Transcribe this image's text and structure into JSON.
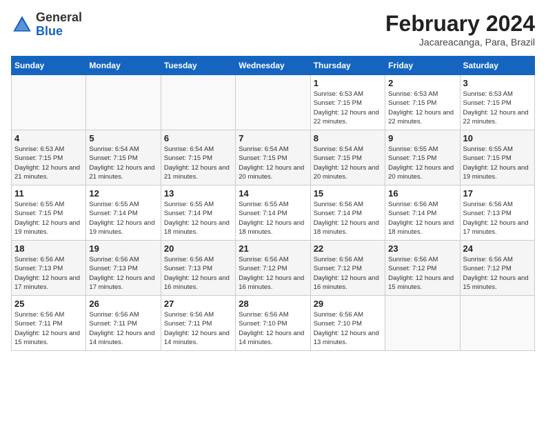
{
  "header": {
    "logo": {
      "general": "General",
      "blue": "Blue"
    },
    "month_year": "February 2024",
    "location": "Jacareacanga, Para, Brazil"
  },
  "days_of_week": [
    "Sunday",
    "Monday",
    "Tuesday",
    "Wednesday",
    "Thursday",
    "Friday",
    "Saturday"
  ],
  "weeks": [
    [
      {
        "day": "",
        "sunrise": "",
        "sunset": "",
        "daylight": ""
      },
      {
        "day": "",
        "sunrise": "",
        "sunset": "",
        "daylight": ""
      },
      {
        "day": "",
        "sunrise": "",
        "sunset": "",
        "daylight": ""
      },
      {
        "day": "",
        "sunrise": "",
        "sunset": "",
        "daylight": ""
      },
      {
        "day": "1",
        "sunrise": "Sunrise: 6:53 AM",
        "sunset": "Sunset: 7:15 PM",
        "daylight": "Daylight: 12 hours and 22 minutes."
      },
      {
        "day": "2",
        "sunrise": "Sunrise: 6:53 AM",
        "sunset": "Sunset: 7:15 PM",
        "daylight": "Daylight: 12 hours and 22 minutes."
      },
      {
        "day": "3",
        "sunrise": "Sunrise: 6:53 AM",
        "sunset": "Sunset: 7:15 PM",
        "daylight": "Daylight: 12 hours and 22 minutes."
      }
    ],
    [
      {
        "day": "4",
        "sunrise": "Sunrise: 6:53 AM",
        "sunset": "Sunset: 7:15 PM",
        "daylight": "Daylight: 12 hours and 21 minutes."
      },
      {
        "day": "5",
        "sunrise": "Sunrise: 6:54 AM",
        "sunset": "Sunset: 7:15 PM",
        "daylight": "Daylight: 12 hours and 21 minutes."
      },
      {
        "day": "6",
        "sunrise": "Sunrise: 6:54 AM",
        "sunset": "Sunset: 7:15 PM",
        "daylight": "Daylight: 12 hours and 21 minutes."
      },
      {
        "day": "7",
        "sunrise": "Sunrise: 6:54 AM",
        "sunset": "Sunset: 7:15 PM",
        "daylight": "Daylight: 12 hours and 20 minutes."
      },
      {
        "day": "8",
        "sunrise": "Sunrise: 6:54 AM",
        "sunset": "Sunset: 7:15 PM",
        "daylight": "Daylight: 12 hours and 20 minutes."
      },
      {
        "day": "9",
        "sunrise": "Sunrise: 6:55 AM",
        "sunset": "Sunset: 7:15 PM",
        "daylight": "Daylight: 12 hours and 20 minutes."
      },
      {
        "day": "10",
        "sunrise": "Sunrise: 6:55 AM",
        "sunset": "Sunset: 7:15 PM",
        "daylight": "Daylight: 12 hours and 19 minutes."
      }
    ],
    [
      {
        "day": "11",
        "sunrise": "Sunrise: 6:55 AM",
        "sunset": "Sunset: 7:15 PM",
        "daylight": "Daylight: 12 hours and 19 minutes."
      },
      {
        "day": "12",
        "sunrise": "Sunrise: 6:55 AM",
        "sunset": "Sunset: 7:14 PM",
        "daylight": "Daylight: 12 hours and 19 minutes."
      },
      {
        "day": "13",
        "sunrise": "Sunrise: 6:55 AM",
        "sunset": "Sunset: 7:14 PM",
        "daylight": "Daylight: 12 hours and 18 minutes."
      },
      {
        "day": "14",
        "sunrise": "Sunrise: 6:55 AM",
        "sunset": "Sunset: 7:14 PM",
        "daylight": "Daylight: 12 hours and 18 minutes."
      },
      {
        "day": "15",
        "sunrise": "Sunrise: 6:56 AM",
        "sunset": "Sunset: 7:14 PM",
        "daylight": "Daylight: 12 hours and 18 minutes."
      },
      {
        "day": "16",
        "sunrise": "Sunrise: 6:56 AM",
        "sunset": "Sunset: 7:14 PM",
        "daylight": "Daylight: 12 hours and 18 minutes."
      },
      {
        "day": "17",
        "sunrise": "Sunrise: 6:56 AM",
        "sunset": "Sunset: 7:13 PM",
        "daylight": "Daylight: 12 hours and 17 minutes."
      }
    ],
    [
      {
        "day": "18",
        "sunrise": "Sunrise: 6:56 AM",
        "sunset": "Sunset: 7:13 PM",
        "daylight": "Daylight: 12 hours and 17 minutes."
      },
      {
        "day": "19",
        "sunrise": "Sunrise: 6:56 AM",
        "sunset": "Sunset: 7:13 PM",
        "daylight": "Daylight: 12 hours and 17 minutes."
      },
      {
        "day": "20",
        "sunrise": "Sunrise: 6:56 AM",
        "sunset": "Sunset: 7:13 PM",
        "daylight": "Daylight: 12 hours and 16 minutes."
      },
      {
        "day": "21",
        "sunrise": "Sunrise: 6:56 AM",
        "sunset": "Sunset: 7:12 PM",
        "daylight": "Daylight: 12 hours and 16 minutes."
      },
      {
        "day": "22",
        "sunrise": "Sunrise: 6:56 AM",
        "sunset": "Sunset: 7:12 PM",
        "daylight": "Daylight: 12 hours and 16 minutes."
      },
      {
        "day": "23",
        "sunrise": "Sunrise: 6:56 AM",
        "sunset": "Sunset: 7:12 PM",
        "daylight": "Daylight: 12 hours and 15 minutes."
      },
      {
        "day": "24",
        "sunrise": "Sunrise: 6:56 AM",
        "sunset": "Sunset: 7:12 PM",
        "daylight": "Daylight: 12 hours and 15 minutes."
      }
    ],
    [
      {
        "day": "25",
        "sunrise": "Sunrise: 6:56 AM",
        "sunset": "Sunset: 7:11 PM",
        "daylight": "Daylight: 12 hours and 15 minutes."
      },
      {
        "day": "26",
        "sunrise": "Sunrise: 6:56 AM",
        "sunset": "Sunset: 7:11 PM",
        "daylight": "Daylight: 12 hours and 14 minutes."
      },
      {
        "day": "27",
        "sunrise": "Sunrise: 6:56 AM",
        "sunset": "Sunset: 7:11 PM",
        "daylight": "Daylight: 12 hours and 14 minutes."
      },
      {
        "day": "28",
        "sunrise": "Sunrise: 6:56 AM",
        "sunset": "Sunset: 7:10 PM",
        "daylight": "Daylight: 12 hours and 14 minutes."
      },
      {
        "day": "29",
        "sunrise": "Sunrise: 6:56 AM",
        "sunset": "Sunset: 7:10 PM",
        "daylight": "Daylight: 12 hours and 13 minutes."
      },
      {
        "day": "",
        "sunrise": "",
        "sunset": "",
        "daylight": ""
      },
      {
        "day": "",
        "sunrise": "",
        "sunset": "",
        "daylight": ""
      }
    ]
  ]
}
